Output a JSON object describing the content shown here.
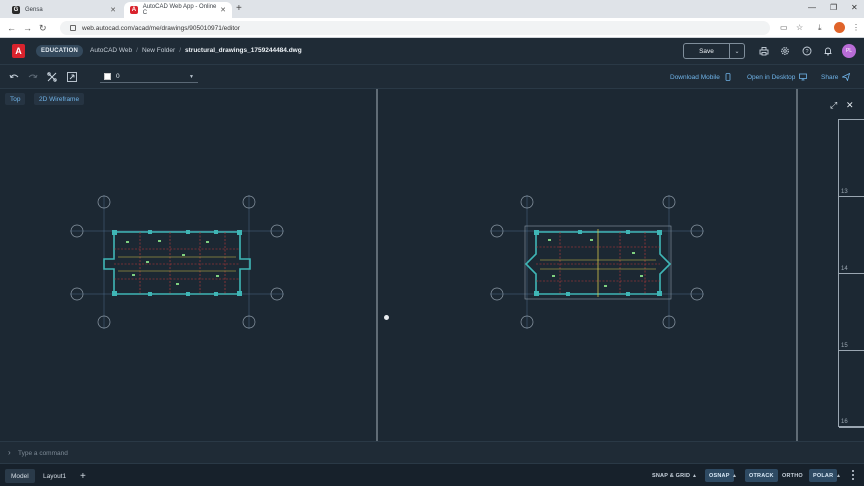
{
  "browser": {
    "tabs": [
      {
        "label": "Gensa",
        "active": false
      },
      {
        "label": "AutoCAD Web App - Online C",
        "active": true
      }
    ],
    "url": "web.autocad.com/acad/me/drawings/905010971/editor"
  },
  "header": {
    "badge": "EDUCATION",
    "breadcrumb": [
      "AutoCAD Web",
      "New Folder",
      "structural_drawings_1759244484.dwg"
    ],
    "save_label": "Save",
    "user_initials": "PL",
    "accent": "#d9232d"
  },
  "toolbar": {
    "layer_value": "0",
    "download_mobile": "Download Mobile",
    "open_desktop": "Open in Desktop",
    "share": "Share"
  },
  "viewport": {
    "view_label": "Top",
    "style_label": "2D Wireframe"
  },
  "sheet_numbers": [
    "13",
    "14",
    "15",
    "16"
  ],
  "command": {
    "placeholder": "Type a command"
  },
  "status": {
    "tabs": [
      "Model",
      "Layout1"
    ],
    "toggles": [
      {
        "label": "SNAP & GRID",
        "on": false
      },
      {
        "label": "OSNAP",
        "on": true
      },
      {
        "label": "OTRACK",
        "on": true
      },
      {
        "label": "ORTHO",
        "on": false
      },
      {
        "label": "POLAR",
        "on": true
      }
    ]
  }
}
